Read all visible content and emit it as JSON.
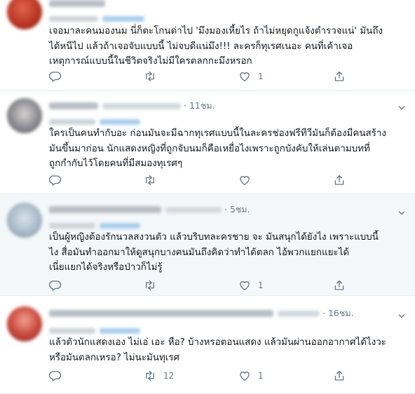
{
  "tweets": [
    {
      "time": "",
      "text_lines": [
        "เจอมาละคนมองนม นี่ก็ตะโกนด่าไป 'มึงมองเหี้ยไร ถ้าไม่หยุดกูแจ้งตำรวจแน่' มันถึง",
        "ได้หนีไป แล้วถ้าเจอจับแบบนี้ ไม่จบดีแน่มึง!!! ละครก็ทุเรศเนอะ คนที่เค้าเจอ",
        "เหตุการณ์แบบนี้ในชีวิตจริงไม่มีใครตลกกะมึงหรอก"
      ],
      "reply_count": "",
      "retweet_count": "",
      "like_count": "1"
    },
    {
      "time": "· 11ชม.",
      "text_lines": [
        "ใครเป็นคนทำกับอะ ก่อนมันจะมีฉากทุเรศแบบนี้ในละครช่องฟรีทีวีมันก็ต้องมีคนสร้าง",
        "มันขึ้นมาก่อน นักแสดงหญิงที่ถูกจับนมก็คือเหยื่อไงเพราะถูกบังคับให้เล่นตามบทที่",
        "ถูกกำกับไว้โดยคนที่มีสมองทุเรศๆ"
      ],
      "reply_count": "",
      "retweet_count": "",
      "like_count": ""
    },
    {
      "time": "· 5ชม.",
      "text_lines": [
        "เป็นผู้หญิงต้องรักนวลสงวนตัว แล้วบริบทละครชาย จะ มันสนุกได้ยังไง เพราะแบบนี้",
        "ไง สื่อมันทำออกมาให้ดูสนุกบางคนมันถึงคิดว่าทำได้ตลก  ไอ้พวกแยกแยะได้",
        "เนี่ยแยกได้จริงหรือป่าวก็ไม่รู้"
      ],
      "reply_count": "",
      "retweet_count": "",
      "like_count": "1"
    },
    {
      "time": "· 16ชม.",
      "text_lines": [
        "แล้วตัวนักแสดงเอง ไม่เอ่ เอะ หือ? บ้างหรอตอนแสดง แล้วมันผ่านออกอากาศได้ไงวะ",
        "หรือมันตลกเหรอ? ไม่นะมันทุเรศ"
      ],
      "reply_count": "",
      "retweet_count": "12",
      "like_count": "1"
    }
  ],
  "icons": {
    "reply": "comment-bubble-icon",
    "retweet": "retweet-arrows-icon",
    "like": "heart-outline-icon",
    "share": "share-upload-icon",
    "more": "chevron-down-icon"
  },
  "colors": {
    "icon": "#657786",
    "text": "#14171a",
    "divider": "#e6ecf0",
    "highlight_bg": "#f5f8fa",
    "link_blue": "#1da1f2"
  }
}
